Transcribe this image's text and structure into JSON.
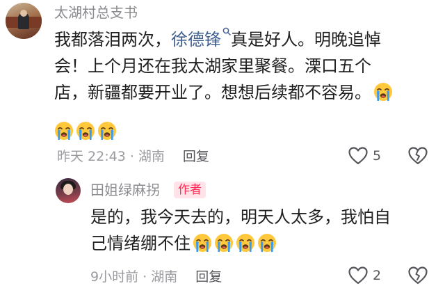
{
  "comment1": {
    "username": "太湖村总支书",
    "line1_before": "我都落泪两次，",
    "mention": "徐德锋",
    "line1_after": "真是好人。明晚追悼",
    "line2": "会！上个月还在我太湖家里聚餐。溧口五个",
    "line3": "店，新疆都要开业了。想想后续都不容易。",
    "time_location": "昨天 22:43 · 湖南",
    "reply_label": "回复",
    "like_count": "5"
  },
  "comment2": {
    "username": "田姐绿麻拐",
    "badge": "作者",
    "line1": "是的，我今天去的，明天人太多，我怕自",
    "line2": "己情绪绷不住",
    "time_location": "9小时前 · 湖南",
    "reply_label": "回复",
    "like_count": "2"
  },
  "icons": {
    "emoji": "loudly-crying-face",
    "like": "heart-outline",
    "dislike": "broken-heart-outline",
    "mention_search": "magnifier"
  },
  "colors": {
    "mention": "#3f5f8f",
    "author_badge_text": "#ff2d55",
    "author_badge_bg": "#ffe3e8",
    "emoji_face": "#ffc83d",
    "emoji_tears": "#3a9cf0"
  }
}
